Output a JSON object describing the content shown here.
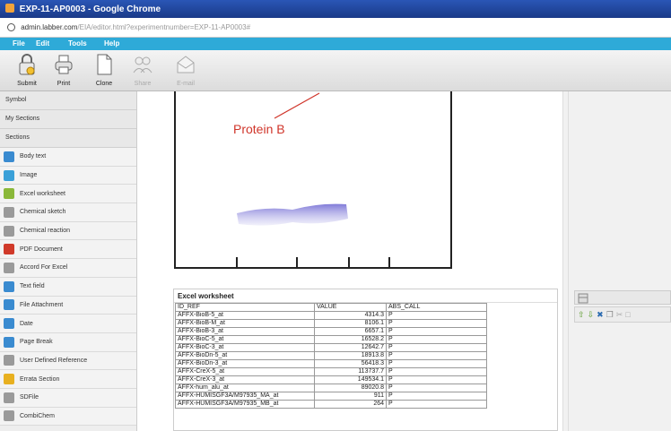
{
  "window": {
    "title": "EXP-11-AP0003 - Google Chrome"
  },
  "address": {
    "host": "admin.labber.com",
    "path": "/EIA/editor.html?experimentnumber=EXP-11-AP0003#"
  },
  "menu": {
    "items": [
      "File",
      "Edit",
      "Tools",
      "Help"
    ]
  },
  "toolbar": {
    "submit": "Submit",
    "print": "Print",
    "clone": "Clone",
    "share": "Share",
    "email": "E-mail"
  },
  "sidebar": {
    "headers": [
      "Symbol",
      "My Sections",
      "Sections"
    ],
    "items": [
      {
        "label": "Body text",
        "icon": "body-text-icon",
        "color": "#3a8bd0"
      },
      {
        "label": "Image",
        "icon": "image-icon",
        "color": "#3aa0d8"
      },
      {
        "label": "Excel worksheet",
        "icon": "excel-icon",
        "color": "#8ab83a"
      },
      {
        "label": "Chemical sketch",
        "icon": "chemical-sketch-icon",
        "color": "#9a9a9a"
      },
      {
        "label": "Chemical reaction",
        "icon": "chemical-reaction-icon",
        "color": "#9a9a9a"
      },
      {
        "label": "PDF Document",
        "icon": "pdf-icon",
        "color": "#d03a2a"
      },
      {
        "label": "Accord For Excel",
        "icon": "accord-excel-icon",
        "color": "#9a9a9a"
      },
      {
        "label": "Text field",
        "icon": "text-field-icon",
        "color": "#3a8bd0"
      },
      {
        "label": "File Attachment",
        "icon": "file-attachment-icon",
        "color": "#3a8bd0"
      },
      {
        "label": "Date",
        "icon": "date-icon",
        "color": "#3a8bd0"
      },
      {
        "label": "Page Break",
        "icon": "page-break-icon",
        "color": "#3a8bd0"
      },
      {
        "label": "User Defined Reference",
        "icon": "user-reference-icon",
        "color": "#9a9a9a"
      },
      {
        "label": "Errata Section",
        "icon": "errata-icon",
        "color": "#e8b020"
      },
      {
        "label": "SDFile",
        "icon": "sdfile-icon",
        "color": "#9a9a9a"
      },
      {
        "label": "CombiChem",
        "icon": "combichem-icon",
        "color": "#9a9a9a"
      }
    ]
  },
  "gel": {
    "label": "Protein B"
  },
  "worksheet": {
    "title": "Excel worksheet",
    "columns": [
      "ID_REF",
      "VALUE",
      "ABS_CALL"
    ],
    "rows": [
      [
        "AFFX-BioB-5_at",
        "4314.3",
        "P"
      ],
      [
        "AFFX-BioB-M_at",
        "8106.1",
        "P"
      ],
      [
        "AFFX-BioB-3_at",
        "6657.1",
        "P"
      ],
      [
        "AFFX-BioC-5_at",
        "16528.2",
        "P"
      ],
      [
        "AFFX-BioC-3_at",
        "12642.7",
        "P"
      ],
      [
        "AFFX-BioDn-5_at",
        "18913.8",
        "P"
      ],
      [
        "AFFX-BioDn-3_at",
        "56418.3",
        "P"
      ],
      [
        "AFFX-CreX-5_at",
        "113737.7",
        "P"
      ],
      [
        "AFFX-CreX-3_at",
        "149534.1",
        "P"
      ],
      [
        "AFFX-hum_alu_at",
        "89020.8",
        "P"
      ],
      [
        "AFFX-HUMISGF3A/M97935_MA_at",
        "911",
        "P"
      ],
      [
        "AFFX-HUMISGF3A/M97935_MB_at",
        "264",
        "P"
      ]
    ]
  },
  "colors": {
    "menubar": "#2eaad8",
    "titlebar": "#1a3a88",
    "gel_label": "#d0352a",
    "band": "#8a86d8"
  }
}
